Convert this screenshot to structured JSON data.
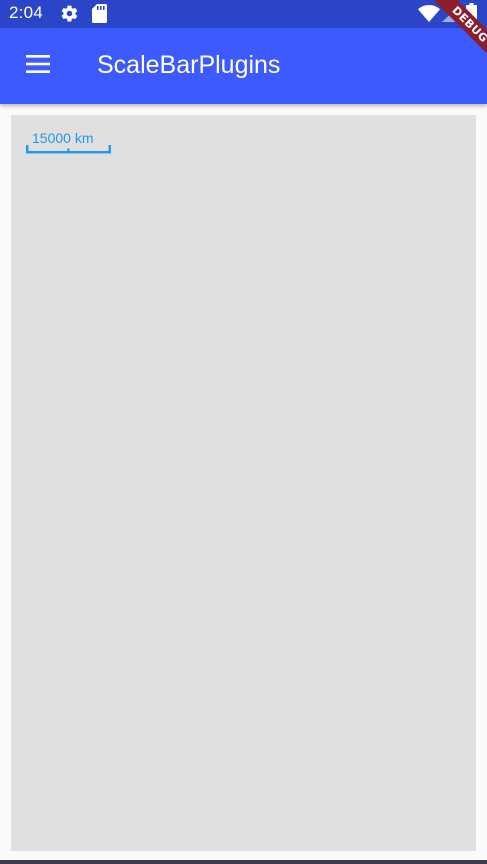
{
  "status_bar": {
    "time": "2:04",
    "icons": [
      "gear-icon",
      "sd-card-icon",
      "wifi-icon",
      "signal-icon",
      "battery-icon"
    ]
  },
  "app_bar": {
    "title": "ScaleBarPlugins",
    "menu_icon": "hamburger-menu-icon",
    "background": "#3d5afe"
  },
  "debug_banner": {
    "label": "DEBUG"
  },
  "map": {
    "background": "#e0e0e0",
    "scale_bar": {
      "label": "15000 km",
      "color": "#2196f3"
    }
  }
}
